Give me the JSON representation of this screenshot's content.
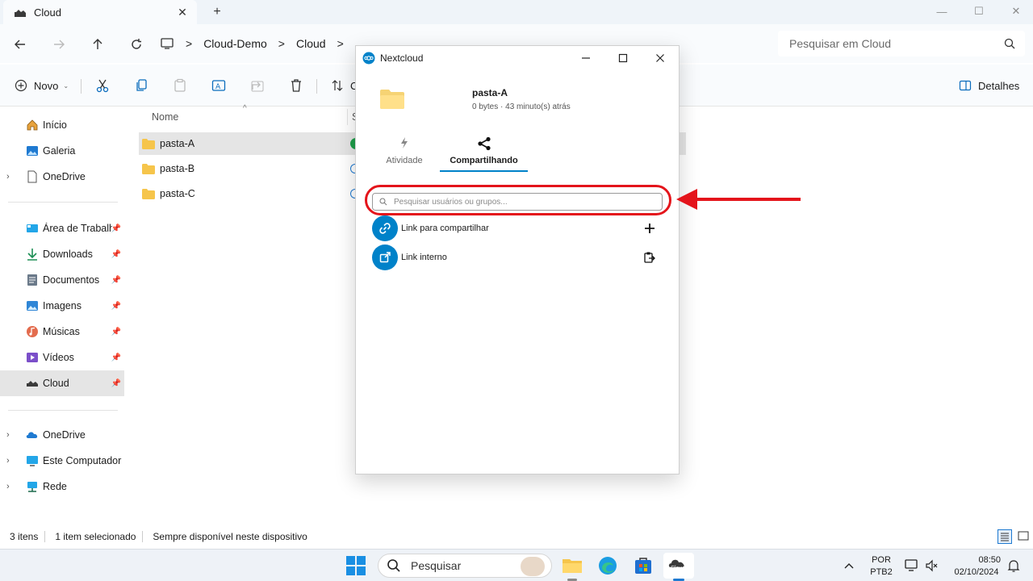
{
  "window": {
    "tab_title": "Cloud",
    "tab_close": "✕",
    "new_tab": "+",
    "min": "—",
    "max": "☐",
    "close": "✕"
  },
  "address": {
    "crumbs": [
      "Cloud-Demo",
      "Cloud"
    ],
    "sep": ">",
    "search_placeholder": "Pesquisar em Cloud"
  },
  "commands": {
    "new_label": "Novo",
    "sort_partial": "C",
    "details_label": "Detalhes"
  },
  "sidebar": {
    "items": [
      {
        "label": "Início",
        "icon": "home-icon"
      },
      {
        "label": "Galeria",
        "icon": "gallery-icon"
      },
      {
        "label": "OneDrive",
        "icon": "document-icon"
      },
      {
        "label": "Área de Trabalho",
        "icon": "desktop-icon"
      },
      {
        "label": "Downloads",
        "icon": "download-icon"
      },
      {
        "label": "Documentos",
        "icon": "documents-icon"
      },
      {
        "label": "Imagens",
        "icon": "pictures-icon"
      },
      {
        "label": "Músicas",
        "icon": "music-icon"
      },
      {
        "label": "Vídeos",
        "icon": "videos-icon"
      },
      {
        "label": "Cloud",
        "icon": "cloud-drive-icon"
      },
      {
        "label": "OneDrive",
        "icon": "onedrive-cloud-icon"
      },
      {
        "label": "Este Computador",
        "icon": "computer-icon"
      },
      {
        "label": "Rede",
        "icon": "network-icon"
      }
    ]
  },
  "files": {
    "col_name": "Nome",
    "col_status_partial": "S",
    "rows": [
      {
        "name": "pasta-A"
      },
      {
        "name": "pasta-B"
      },
      {
        "name": "pasta-C"
      }
    ]
  },
  "status": {
    "count": "3 itens",
    "selected": "1 item selecionado",
    "availability": "Sempre disponível neste dispositivo"
  },
  "taskbar": {
    "search_label": "Pesquisar",
    "lang": "POR",
    "layout": "PTB2",
    "time": "08:50",
    "date": "02/10/2024",
    "cloud_app_label": "Cloud"
  },
  "nextcloud": {
    "title": "Nextcloud",
    "folder_name": "pasta-A",
    "folder_meta": "0 bytes · 43 minuto(s) atrás",
    "tab_activity": "Atividade",
    "tab_sharing": "Compartilhando",
    "search_placeholder": "Pesquisar usuários ou grupos...",
    "share_link_label": "Link para compartilhar",
    "internal_link_label": "Link interno",
    "accent_color": "#0082c9"
  },
  "annotation": {
    "color": "#e4141b"
  }
}
